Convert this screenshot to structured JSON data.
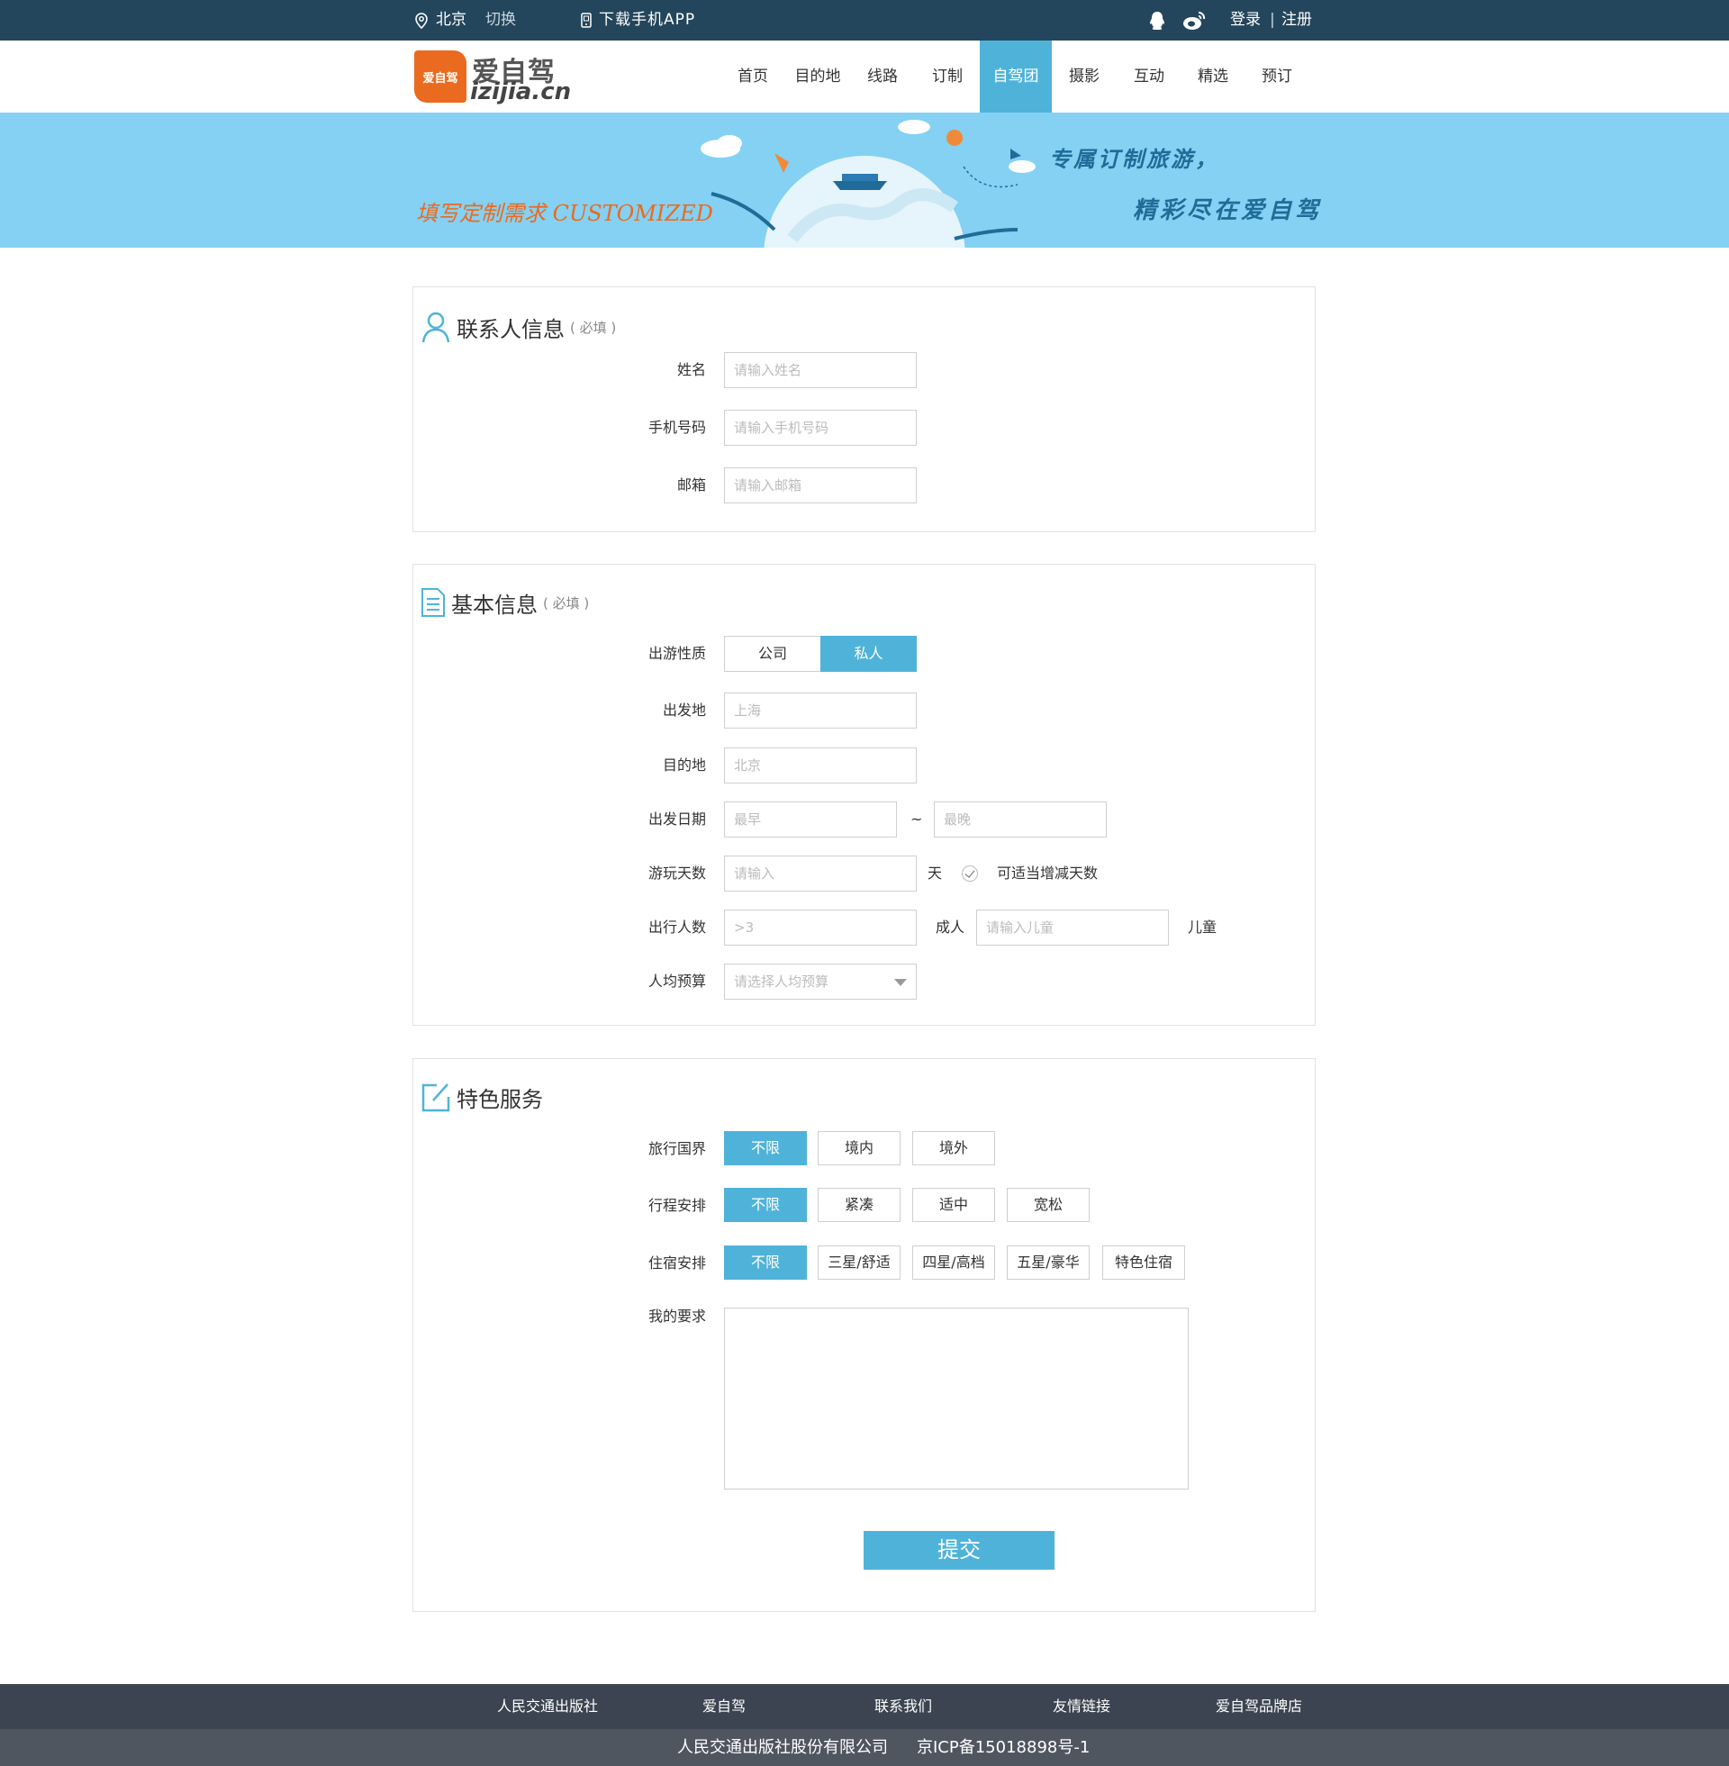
{
  "topbar": {
    "city": "北京",
    "switch": "切换",
    "app": "下载手机APP",
    "login": "登录",
    "separator": "|",
    "register": "注册"
  },
  "logo": {
    "cn": "爱自驾",
    "en": "izijia.cn"
  },
  "nav": {
    "items": [
      "首页",
      "目的地",
      "线路",
      "订制",
      "自驾团",
      "摄影",
      "互动",
      "精选",
      "预订"
    ],
    "active": "自驾团"
  },
  "banner": {
    "left_text": "填写定制需求 CUSTOMIZED",
    "right_line1": "专属订制旅游，",
    "right_line2": "精彩尽在爱自驾"
  },
  "contact": {
    "title": "联系人信息",
    "required": "( 必填 )",
    "name_label": "姓名",
    "name_placeholder": "请输入姓名",
    "phone_label": "手机号码",
    "phone_placeholder": "请输入手机号码",
    "email_label": "邮箱",
    "email_placeholder": "请输入邮箱"
  },
  "basic": {
    "title": "基本信息",
    "required": "( 必填 )",
    "nature_label": "出游性质",
    "nature_options": [
      "公司",
      "私人"
    ],
    "nature_selected": "私人",
    "from_label": "出发地",
    "from_placeholder": "上海",
    "to_label": "目的地",
    "to_placeholder": "北京",
    "date_label": "出发日期",
    "date_earliest": "最早",
    "date_tilde": "~",
    "date_latest": "最晚",
    "days_label": "游玩天数",
    "days_placeholder": "请输入",
    "days_unit": "天",
    "days_adjust": "可适当增减天数",
    "people_label": "出行人数",
    "adults_placeholder": ">3",
    "adults_unit": "成人",
    "children_placeholder": "请输入儿童",
    "children_unit": "儿童",
    "budget_label": "人均预算",
    "budget_placeholder": "请选择人均预算"
  },
  "special": {
    "title": "特色服务",
    "border_label": "旅行国界",
    "border_options": [
      "不限",
      "境内",
      "境外"
    ],
    "schedule_label": "行程安排",
    "schedule_options": [
      "不限",
      "紧凑",
      "适中",
      "宽松"
    ],
    "stay_label": "住宿安排",
    "stay_options": [
      "不限",
      "三星/舒适",
      "四星/高档",
      "五星/豪华",
      "特色住宿"
    ],
    "request_label": "我的要求",
    "submit": "提交"
  },
  "footer": {
    "links": [
      "人民交通出版社",
      "爱自驾",
      "联系我们",
      "友情链接",
      "爱自驾品牌店"
    ],
    "company": "人民交通出版社股份有限公司",
    "icp": "京ICP备15018898号-1"
  },
  "colors": {
    "topbar_bg": "#23465c",
    "accent": "#4fb3d9",
    "banner_bg": "#84d1f3",
    "brand_orange": "#ea6a1f",
    "footer_bg": "#3b4450"
  }
}
